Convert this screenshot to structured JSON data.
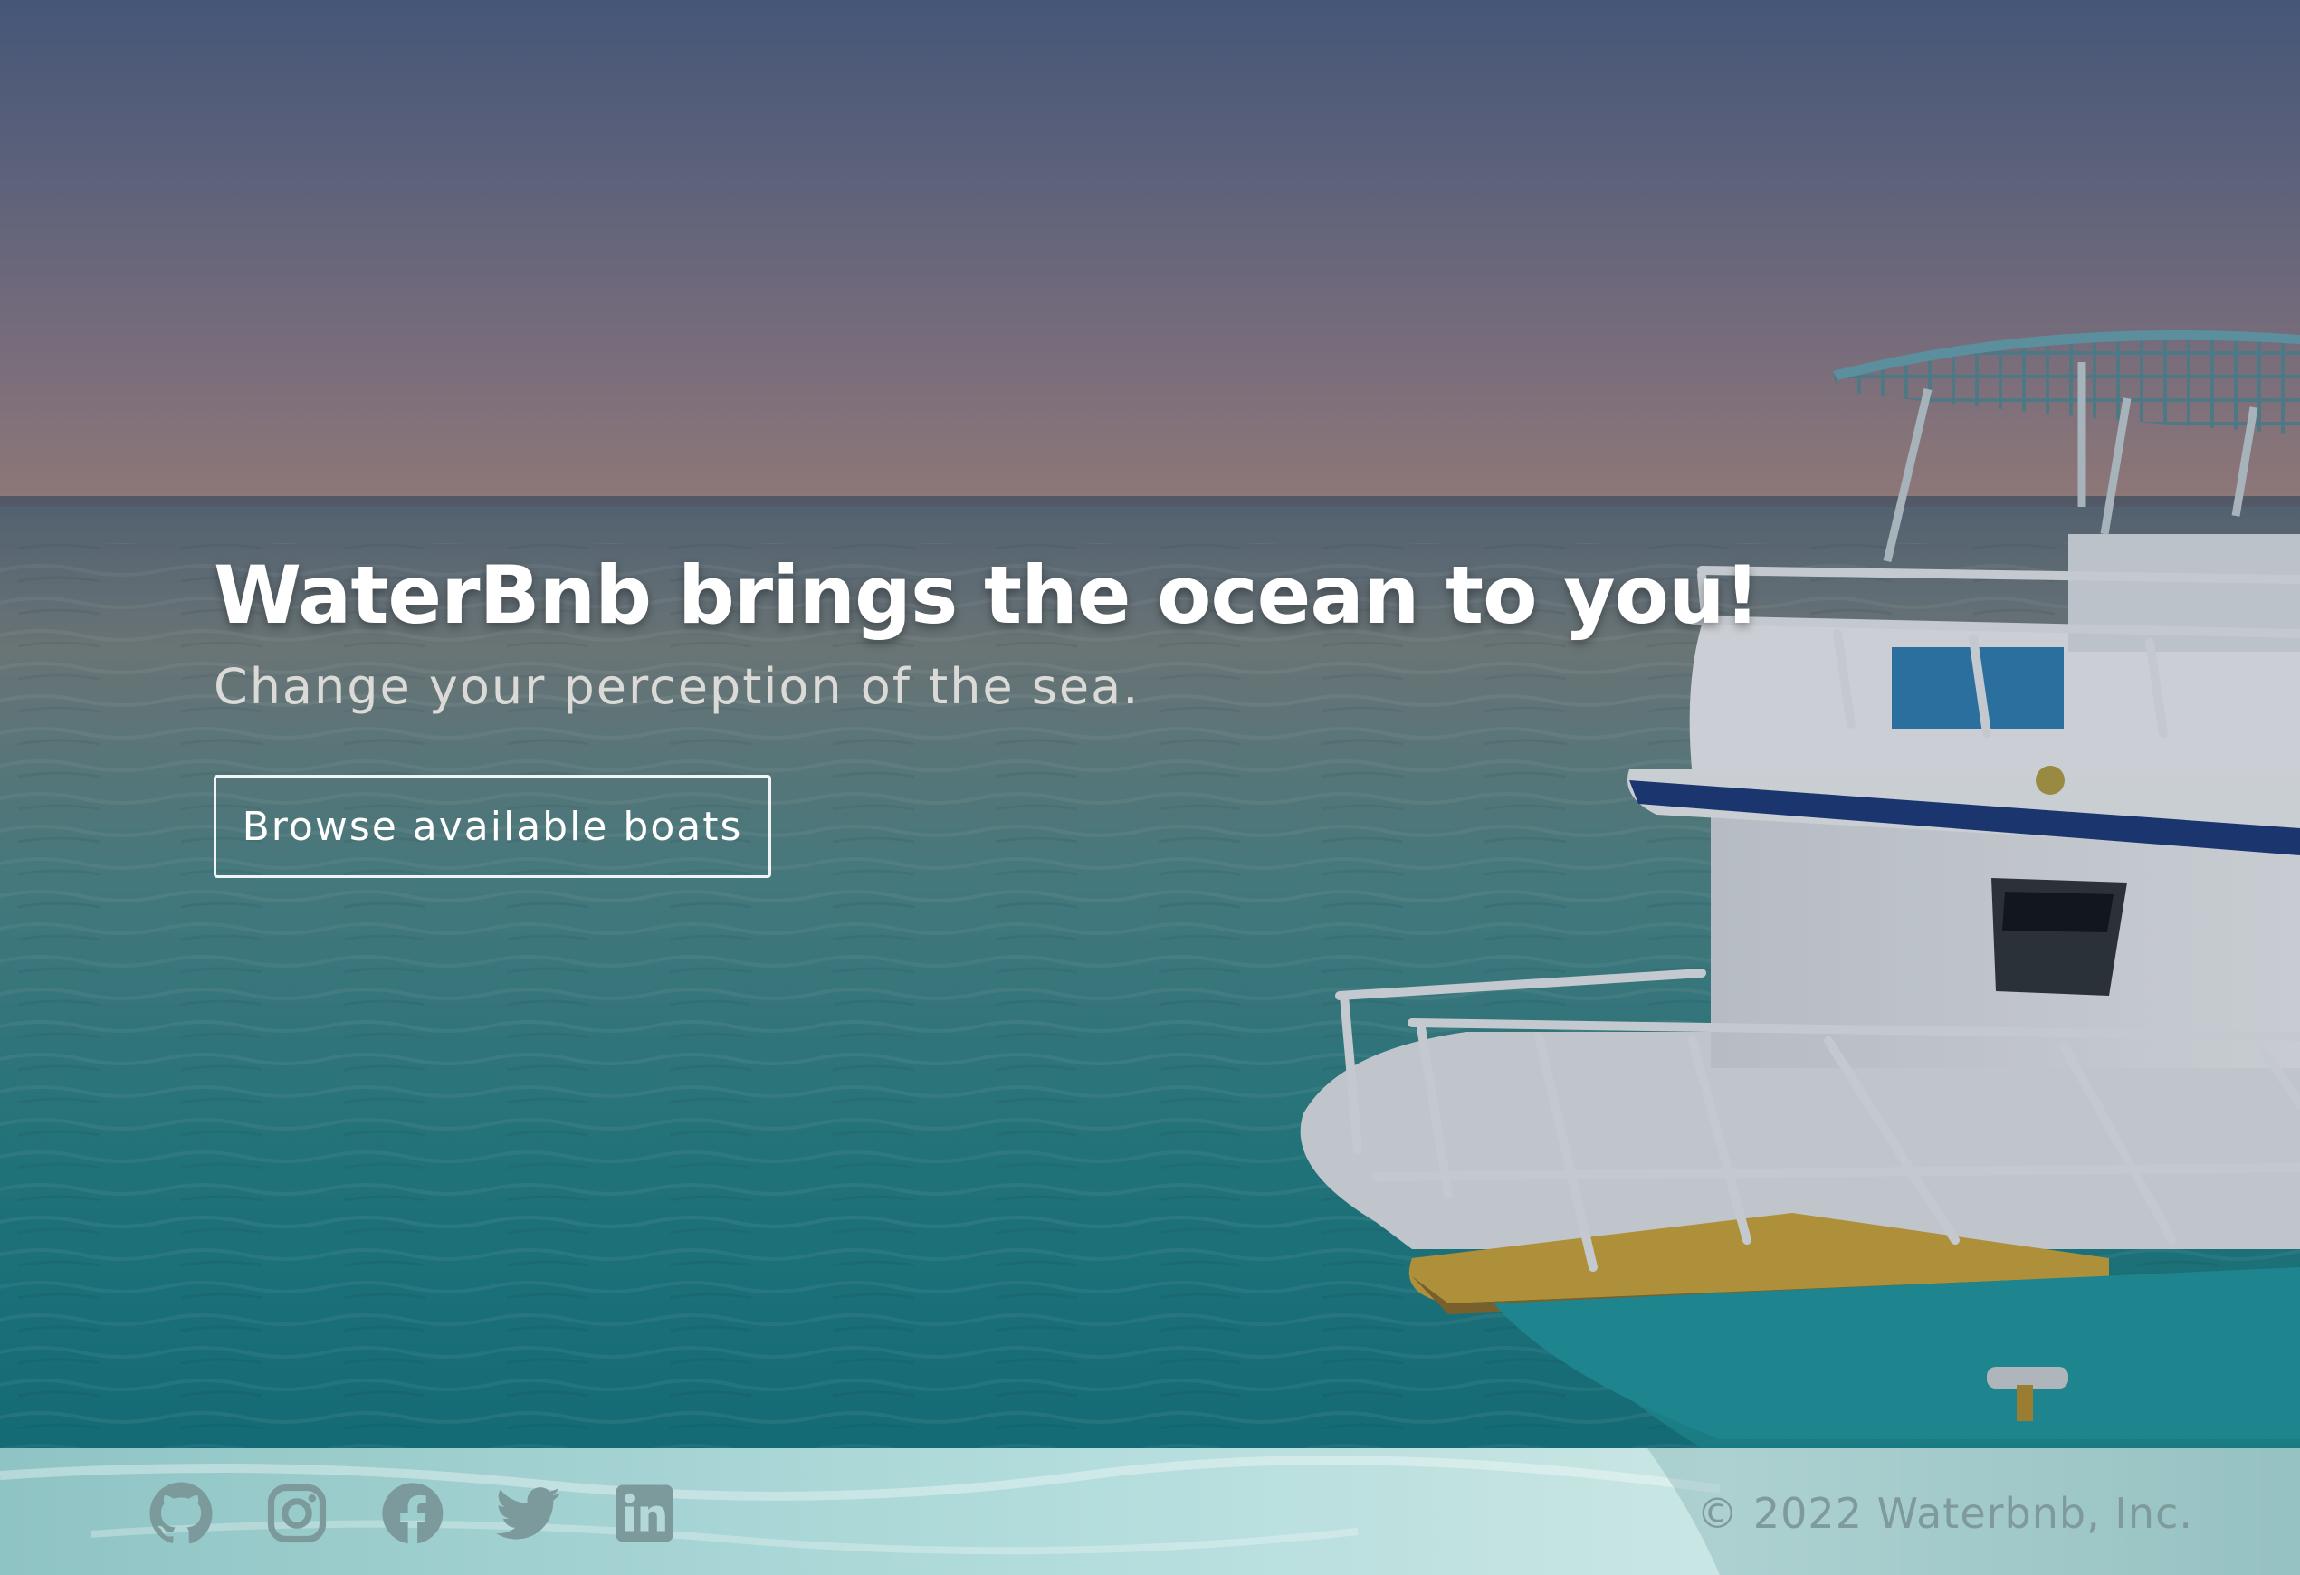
{
  "hero": {
    "title": "WaterBnb brings the ocean to you!",
    "subtitle": "Change your perception of the sea.",
    "cta_label": "Browse available boats"
  },
  "footer": {
    "social": [
      {
        "name": "github-icon",
        "label": "GitHub"
      },
      {
        "name": "instagram-icon",
        "label": "Instagram"
      },
      {
        "name": "facebook-icon",
        "label": "Facebook"
      },
      {
        "name": "twitter-icon",
        "label": "Twitter"
      },
      {
        "name": "linkedin-icon",
        "label": "LinkedIn"
      }
    ],
    "copyright": "© 2022 Waterbnb, Inc."
  },
  "colors": {
    "sky_top": "#4f6185",
    "sky_horizon": "#a58a86",
    "sea_far": "#6f8a8c",
    "sea_near": "#157f86",
    "footer_bg": "#a9d3d3",
    "footer_text": "#7f9a9a",
    "footer_icons": "#7c9a9c",
    "boat_white": "#e8ecef",
    "boat_teal": "#23a3a6",
    "boat_stripe": "#1c3a7a",
    "deck_wood": "#d0a83a"
  }
}
